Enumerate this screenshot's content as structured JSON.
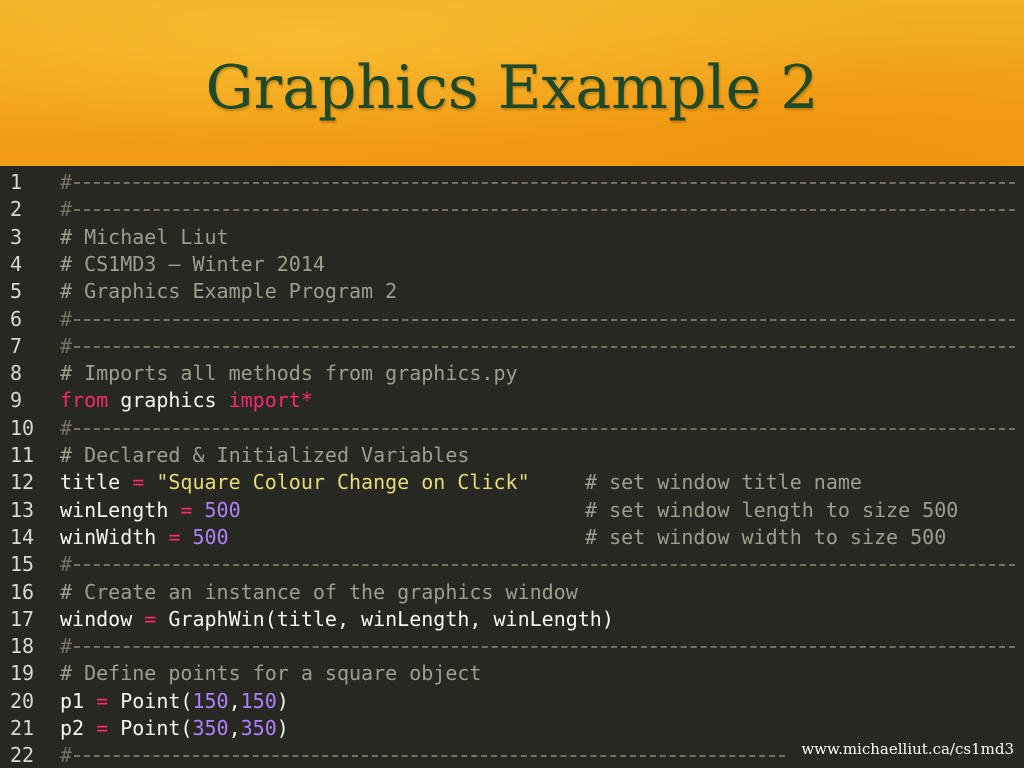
{
  "slide": {
    "title": "Graphics Example 2",
    "footer_url": "www.michaelliut.ca/cs1md3"
  },
  "colors": {
    "header_bg": "#f2a31a",
    "title_text": "#1f4a2a",
    "editor_bg": "#272822",
    "comment": "#a09d8c",
    "keyword": "#f92672",
    "string": "#e6db74",
    "number": "#ae81ff"
  },
  "code": {
    "rule_hash": "#",
    "lines": [
      {
        "n": "1"
      },
      {
        "n": "2"
      },
      {
        "n": "3",
        "comment": "# Michael Liut"
      },
      {
        "n": "4",
        "comment": "# CS1MD3 – Winter 2014"
      },
      {
        "n": "5",
        "comment": "# Graphics Example Program 2"
      },
      {
        "n": "6"
      },
      {
        "n": "7"
      },
      {
        "n": "8",
        "comment": "# Imports all methods from graphics.py"
      },
      {
        "n": "9",
        "kw1": "from",
        "name": " graphics ",
        "kw2": "import*"
      },
      {
        "n": "10"
      },
      {
        "n": "11",
        "comment": "# Declared & Initialized Variables"
      },
      {
        "n": "12",
        "var": "title",
        "op": " = ",
        "value": "\"Square Colour Change on Click\"",
        "inline_comment": "# set window title name"
      },
      {
        "n": "13",
        "var": "winLength",
        "op": " = ",
        "value": "500",
        "inline_comment": "# set window length to size 500"
      },
      {
        "n": "14",
        "var": "winWidth",
        "op": " = ",
        "value": "500",
        "inline_comment": "# set window width to size 500"
      },
      {
        "n": "15"
      },
      {
        "n": "16",
        "comment": "# Create an instance of the graphics window"
      },
      {
        "n": "17",
        "var": "window",
        "op": " = ",
        "rest": "GraphWin(title, winLength, winLength)"
      },
      {
        "n": "18"
      },
      {
        "n": "19",
        "comment": "# Define points for a square object"
      },
      {
        "n": "20",
        "var": "p1",
        "op": " = ",
        "fn": "Point(",
        "a": "150",
        "comma": ",",
        "b": "150",
        "close": ")"
      },
      {
        "n": "21",
        "var": "p2",
        "op": " = ",
        "fn": "Point(",
        "a": "350",
        "comma": ",",
        "b": "350",
        "close": ")"
      },
      {
        "n": "22"
      }
    ]
  }
}
